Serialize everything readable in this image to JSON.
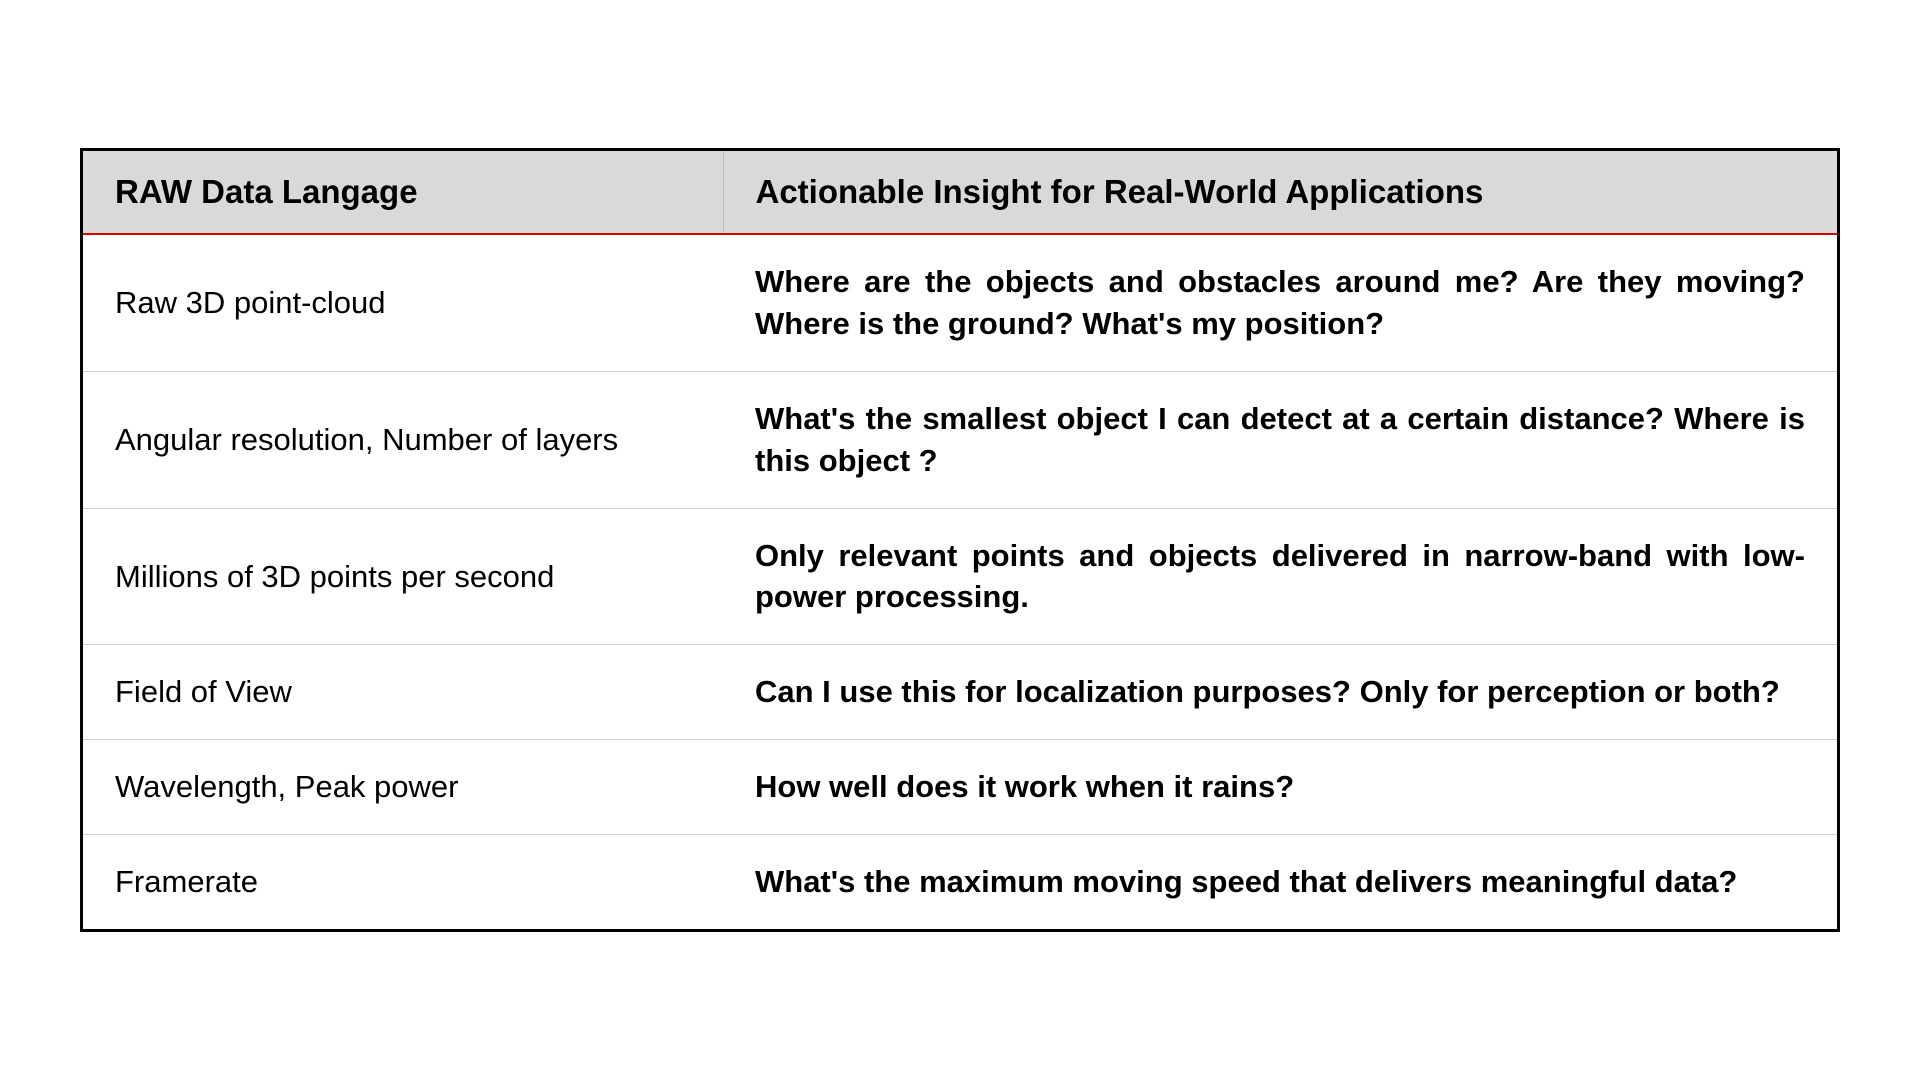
{
  "table": {
    "headers": {
      "col1": "RAW Data Langage",
      "col2": "Actionable Insight for Real-World Applications"
    },
    "rows": [
      {
        "raw": "Raw 3D point-cloud",
        "insight": "Where are the objects and obstacles around me? Are they moving? Where is the ground?  What's my position?"
      },
      {
        "raw": "Angular resolution, Number of layers",
        "insight": "What's the smallest object I can detect at a certain distance?  Where is this object ?"
      },
      {
        "raw": "Millions of 3D points per second",
        "insight": "Only relevant points and objects delivered in narrow-band with low-power processing."
      },
      {
        "raw": "Field of View",
        "insight": "Can I use this for localization purposes? Only for perception or both?"
      },
      {
        "raw": "Wavelength, Peak power",
        "insight": "How well does it work when it rains?"
      },
      {
        "raw": "Framerate",
        "insight": "What's the maximum moving speed that delivers meaningful data?"
      }
    ]
  }
}
